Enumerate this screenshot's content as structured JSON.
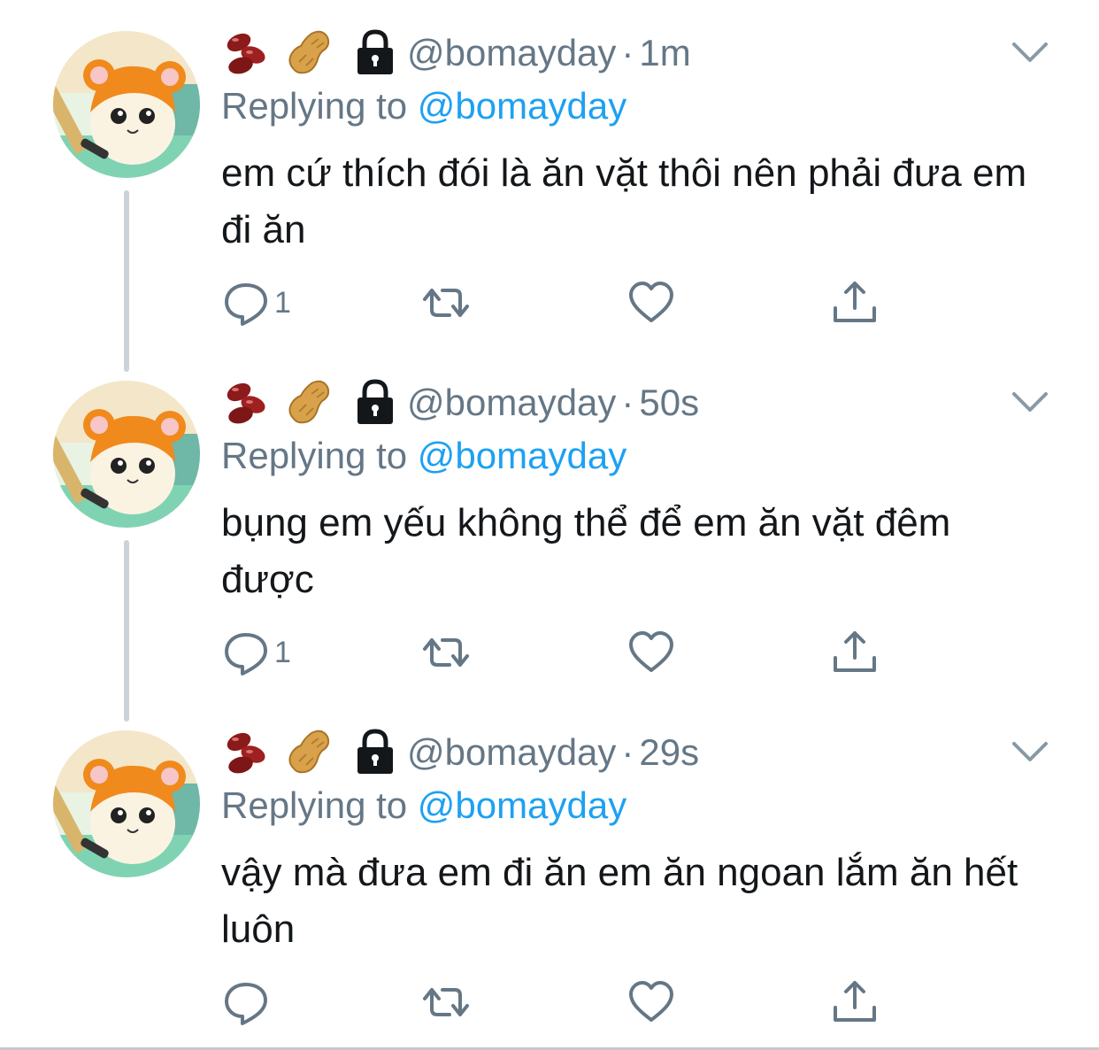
{
  "colors": {
    "text": "#14171a",
    "secondary": "#657786",
    "link": "#1da1f2",
    "thread_line": "#cbd3da"
  },
  "tweets": [
    {
      "handle": "@bomayday",
      "separator": "·",
      "time": "1m",
      "replying_label": "Replying to",
      "replying_to": "@bomayday",
      "text": "em cứ thích đói là ăn vặt thôi nên phải đưa em đi ăn",
      "reply_count": "1",
      "icons": [
        "beans-emoji",
        "peanut-emoji",
        "lock-icon"
      ]
    },
    {
      "handle": "@bomayday",
      "separator": "·",
      "time": "50s",
      "replying_label": "Replying to",
      "replying_to": "@bomayday",
      "text": "bụng em yếu không thể để em ăn vặt đêm được",
      "reply_count": "1",
      "icons": [
        "beans-emoji",
        "peanut-emoji",
        "lock-icon"
      ]
    },
    {
      "handle": "@bomayday",
      "separator": "·",
      "time": "29s",
      "replying_label": "Replying to",
      "replying_to": "@bomayday",
      "text": "vậy mà đưa em đi ăn em ăn ngoan lắm ăn hết luôn",
      "reply_count": "",
      "icons": [
        "beans-emoji",
        "peanut-emoji",
        "lock-icon"
      ]
    }
  ]
}
